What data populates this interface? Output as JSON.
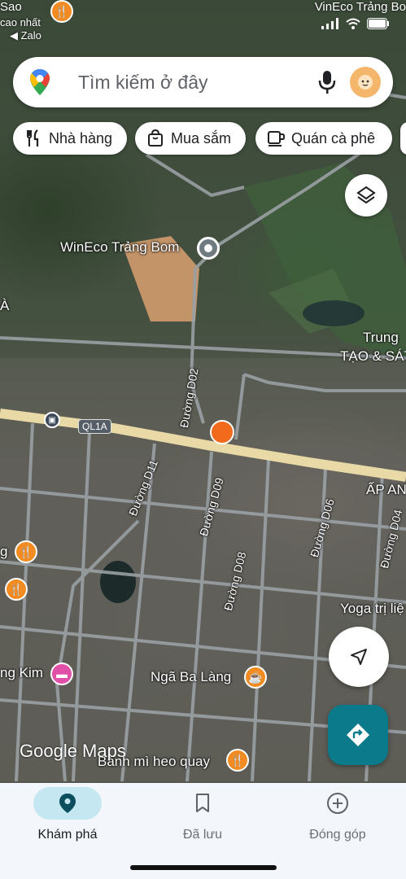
{
  "status_bar": {
    "top_left_1": "Sao",
    "top_left_2": "cao nhất",
    "back_app": "◀ Zalo",
    "top_right": "VinEco Trảng Bo"
  },
  "search": {
    "placeholder": "Tìm kiếm ở đây",
    "mic_icon": "mic-icon",
    "avatar_icon": "avatar"
  },
  "chips": [
    {
      "label": "Nhà hàng",
      "icon": "restaurant-icon"
    },
    {
      "label": "Mua sắm",
      "icon": "shopping-bag-icon"
    },
    {
      "label": "Quán cà phê",
      "icon": "coffee-icon"
    }
  ],
  "map_labels": {
    "wineco": "WinEco Trảng Bom",
    "trung": "Trung",
    "tao_sat": "TẠO & SÁT",
    "ql1a": "QL1A",
    "ap_an": "ẤP AN",
    "yoga": "Yoga trị liệ",
    "kim": "ng Kim",
    "nga_ba_lang": "Ngã Ba Làng",
    "banh_mi": "Bánh mì heo quay",
    "left_a": "À",
    "left_g": "g"
  },
  "roads": {
    "d02": "Đường D02",
    "d11": "Đường D11",
    "d09": "Đường D09",
    "d08": "Đường D08",
    "d06": "Đường D06",
    "d04": "Đường D04"
  },
  "google_maps": "Google Maps",
  "bottom_nav": [
    {
      "label": "Khám phá",
      "icon": "explore-pin-icon",
      "active": true
    },
    {
      "label": "Đã lưu",
      "icon": "bookmark-icon",
      "active": false
    },
    {
      "label": "Đóng góp",
      "icon": "add-circle-icon",
      "active": false
    }
  ],
  "colors": {
    "active_pill": "#c4e7f1",
    "directions_button": "#0b7a8a",
    "pin_orange": "#f28b22"
  }
}
